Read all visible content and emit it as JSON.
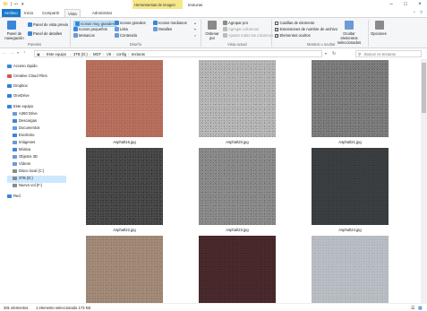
{
  "window": {
    "context_tab": "Herramientas de imagen",
    "title": "texturas"
  },
  "ribbon_tabs": [
    {
      "label": "Archivo"
    },
    {
      "label": "Inicio"
    },
    {
      "label": "Compartir"
    },
    {
      "label": "Vista"
    },
    {
      "label": "Administrar"
    }
  ],
  "ribbon": {
    "panes": {
      "nav_pane": "Panel de navegación",
      "preview_pane": "Panel de vista previa",
      "details_pane": "Panel de detalles",
      "label": "Paneles"
    },
    "layout": {
      "xl_icons": "Iconos muy grandes",
      "large_icons": "Iconos grandes",
      "medium_icons": "Iconos medianos",
      "small_icons": "Iconos pequeños",
      "list": "Lista",
      "details": "Detalles",
      "tiles": "Mosaicos",
      "content": "Contenido",
      "label": "Diseño"
    },
    "current_view": {
      "sort_by": "Ordenar por",
      "group_by": "Agrupar por",
      "add_columns": "Agregar columnas",
      "fit_columns": "Ajustar todas las columnas",
      "label": "Vista actual"
    },
    "show_hide": {
      "item_checkboxes": "Casillas de elemento",
      "file_extensions": "Extensiones de nombre de archivo",
      "hidden_items": "Elementos ocultos",
      "hide_selected": "Ocultar elementos seleccionados",
      "options": "Opciones",
      "label": "Mostrar u ocultar"
    }
  },
  "address": {
    "crumbs": [
      "Este equipo",
      "3TB (D:)",
      "MDT",
      "V8",
      "config",
      "texturas"
    ],
    "search_placeholder": "Buscar en texturas"
  },
  "sidebar": {
    "items": [
      {
        "label": "Acceso rápido",
        "icon": "star-icon",
        "color": "#3a87d6"
      },
      {
        "label": "Creative Cloud Files",
        "icon": "cloud-icon",
        "color": "#d9534f"
      },
      {
        "label": "Dropbox",
        "icon": "dropbox-icon",
        "color": "#2f7fe0"
      },
      {
        "label": "OneDrive",
        "icon": "onedrive-icon",
        "color": "#2f7fe0"
      },
      {
        "label": "Este equipo",
        "icon": "pc-icon",
        "color": "#3a87d6"
      },
      {
        "label": "A360 Drive",
        "icon": "drive-icon",
        "color": "#6a9bd6"
      },
      {
        "label": "Descargas",
        "icon": "download-icon",
        "color": "#3a87d6"
      },
      {
        "label": "Documentos",
        "icon": "documents-icon",
        "color": "#6a9bd6"
      },
      {
        "label": "Escritorio",
        "icon": "desktop-icon",
        "color": "#3a87d6"
      },
      {
        "label": "Imágenes",
        "icon": "pictures-icon",
        "color": "#6a9bd6"
      },
      {
        "label": "Música",
        "icon": "music-icon",
        "color": "#3a87d6"
      },
      {
        "label": "Objetos 3D",
        "icon": "3d-icon",
        "color": "#6a9bd6"
      },
      {
        "label": "Vídeos",
        "icon": "videos-icon",
        "color": "#6a9bd6"
      },
      {
        "label": "Disco local (C:)",
        "icon": "disk-icon",
        "color": "#8a8a8a"
      },
      {
        "label": "3TB (D:)",
        "icon": "disk-icon",
        "color": "#8a8a8a"
      },
      {
        "label": "Nuevo vol (F:)",
        "icon": "disk-icon",
        "color": "#8a8a8a"
      },
      {
        "label": "Red",
        "icon": "network-icon",
        "color": "#3a87d6"
      }
    ]
  },
  "files": [
    {
      "name": "Asphalt16.jpg",
      "color": "#b8705e",
      "texture": "#a35f4f"
    },
    {
      "name": "Asphalt20.jpg",
      "color": "#b8b8b8",
      "texture": "#8f8f8f"
    },
    {
      "name": "Asphalt21.jpg",
      "color": "#7e7e7e",
      "texture": "#5e5e5e"
    },
    {
      "name": "Asphalt22.jpg",
      "color": "#4a4a4a",
      "texture": "#2e2e2e"
    },
    {
      "name": "Asphalt23.jpg",
      "color": "#8c8c8c",
      "texture": "#6c6c6c"
    },
    {
      "name": "Asphalt24.jpg",
      "color": "#3b3f42",
      "texture": "#303437"
    },
    {
      "name": "",
      "color": "#a28b78",
      "texture": "#8d7764"
    },
    {
      "name": "",
      "color": "#4a2a2c",
      "texture": "#3b2022"
    },
    {
      "name": "",
      "color": "#b9bec4",
      "texture": "#a7adb3"
    }
  ],
  "status": {
    "count": "281 elementos",
    "selected": "1 elemento seleccionado  173 KB"
  }
}
